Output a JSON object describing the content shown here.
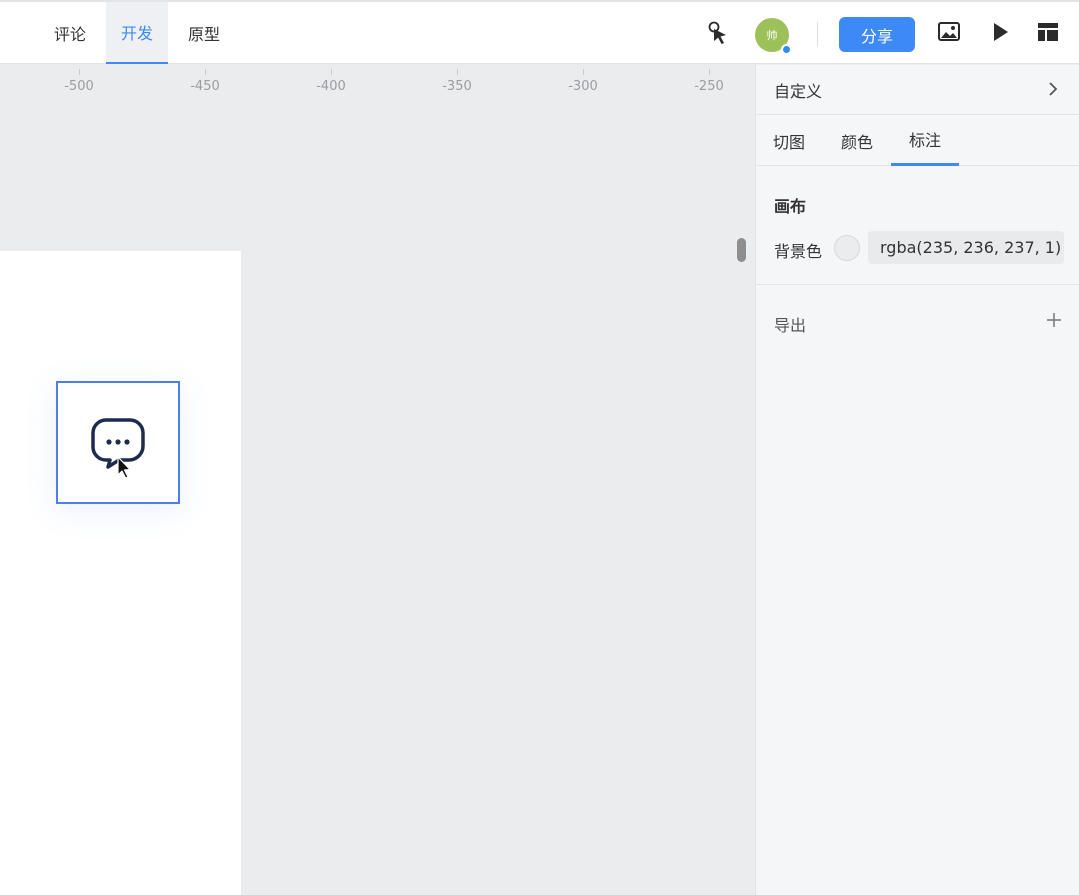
{
  "topbar": {
    "tabs": [
      {
        "label": "评论",
        "active": false
      },
      {
        "label": "开发",
        "active": true
      },
      {
        "label": "原型",
        "active": false
      }
    ],
    "avatar_text": "帅",
    "share_label": "分享",
    "icons": [
      "pointer-hand-icon",
      "image-icon",
      "play-icon",
      "layout-icon"
    ]
  },
  "ruler": {
    "ticks": [
      "-500",
      "-450",
      "-400",
      "-350",
      "-300",
      "-250"
    ]
  },
  "canvas": {
    "selected_icon": "message-more-icon"
  },
  "panel": {
    "header_label": "自定义",
    "subtabs": [
      {
        "label": "切图",
        "active": false
      },
      {
        "label": "颜色",
        "active": false
      },
      {
        "label": "标注",
        "active": true
      }
    ],
    "section_title": "画布",
    "bg_label": "背景色",
    "bg_value": "rgba(235, 236, 237, 1)",
    "bg_color": "#ebeced",
    "export_label": "导出"
  },
  "colors": {
    "accent": "#3d8af7",
    "selection": "#4a80e8",
    "avatar": "#9cc05a"
  }
}
